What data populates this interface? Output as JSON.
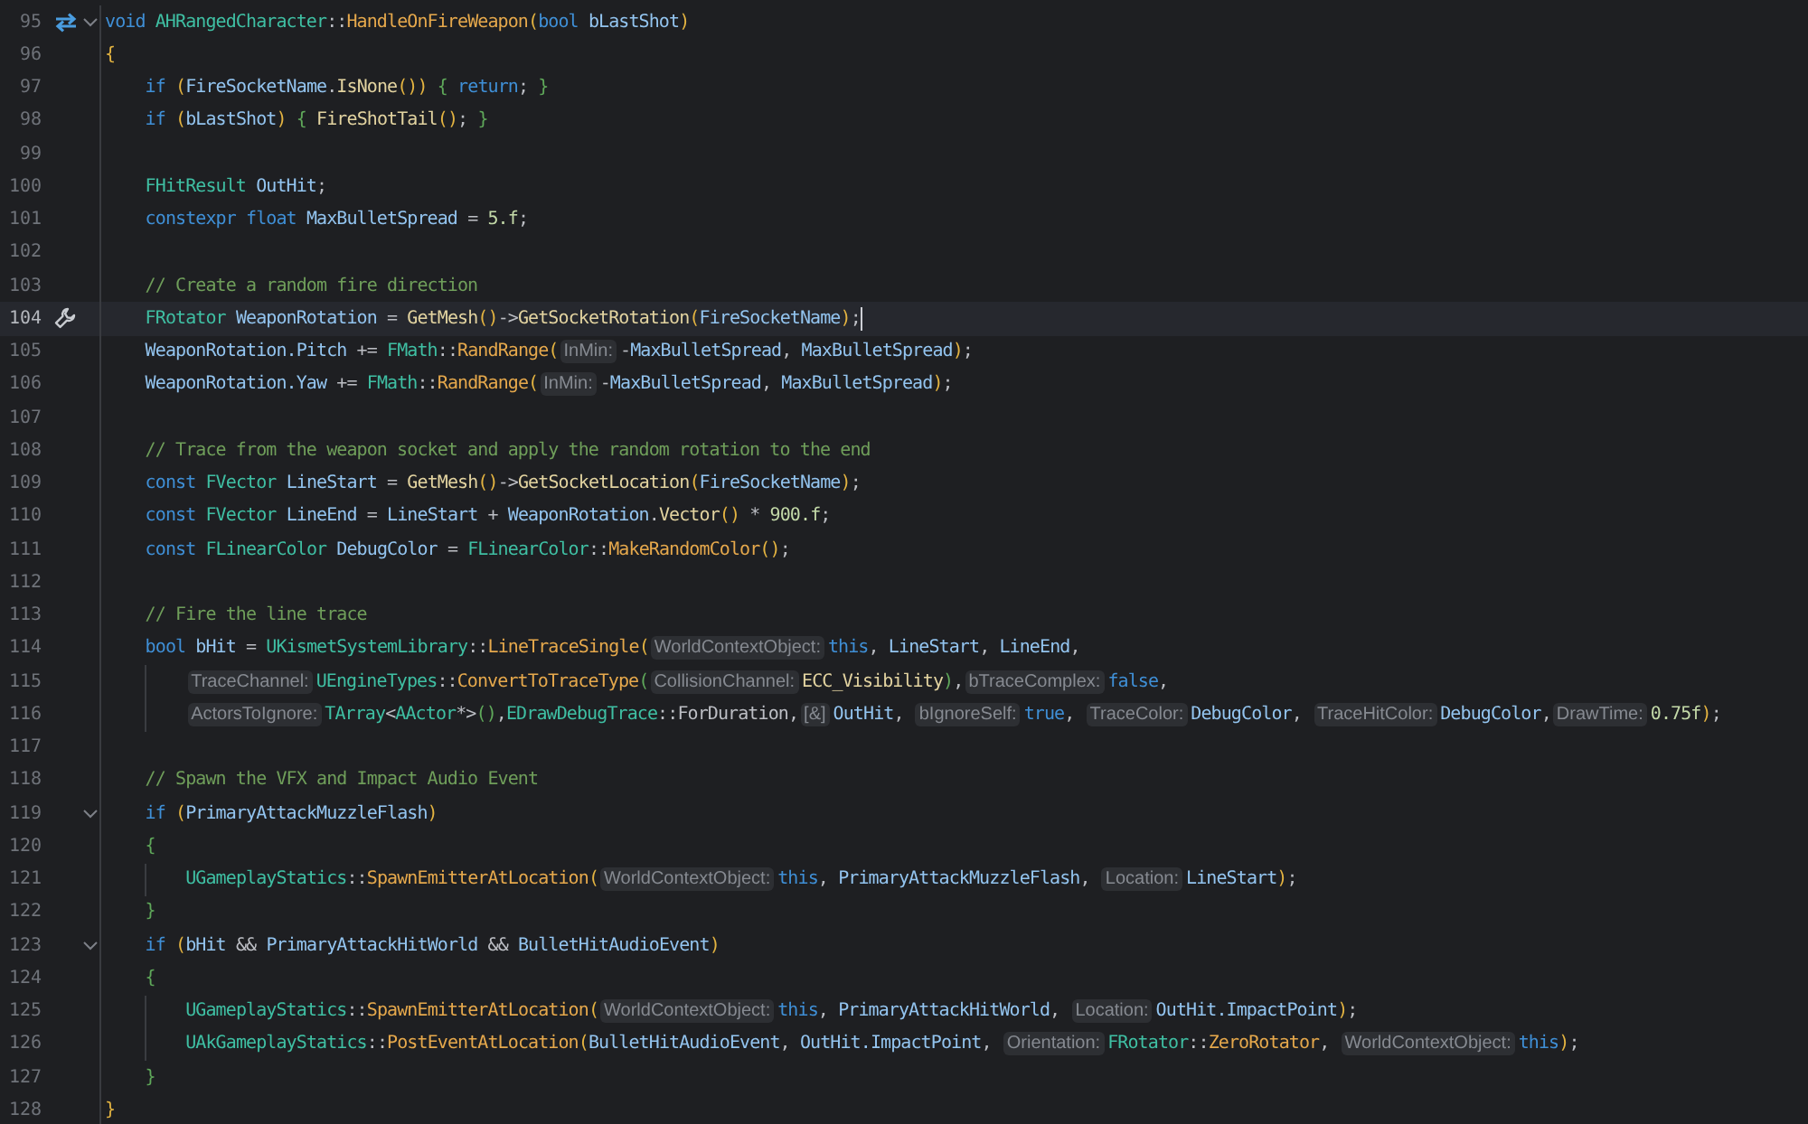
{
  "editor": {
    "lines": [
      {
        "number": "95",
        "current": false,
        "foldable": true,
        "gutter_icon": {
          "kind": "swap"
        },
        "tokens": [
          {
            "kind": "kw",
            "text": "void "
          },
          {
            "kind": "type",
            "text": "AHRangedCharacter"
          },
          {
            "kind": "p",
            "text": "::"
          },
          {
            "kind": "fn",
            "text": "HandleOnFireWeapon"
          },
          {
            "kind": "br",
            "text": "("
          },
          {
            "kind": "kw",
            "text": "bool "
          },
          {
            "kind": "var",
            "text": "bLastShot"
          },
          {
            "kind": "br",
            "text": ")"
          }
        ]
      },
      {
        "number": "96",
        "current": false,
        "foldable": false,
        "tokens": [
          {
            "kind": "br",
            "text": "{"
          }
        ],
        "children": [
          {
            "number": "97",
            "current": false,
            "foldable": false,
            "tokens": [
              {
                "kind": "kw",
                "text": "if "
              },
              {
                "kind": "br",
                "text": "("
              },
              {
                "kind": "var",
                "text": "FireSocketName"
              },
              {
                "kind": "p",
                "text": "."
              },
              {
                "kind": "mt",
                "text": "IsNone"
              },
              {
                "kind": "br",
                "text": "())"
              },
              {
                "kind": "bc",
                "text": " { "
              },
              {
                "kind": "kw",
                "text": "return"
              },
              {
                "kind": "p",
                "text": ";"
              },
              {
                "kind": "bc",
                "text": " }"
              }
            ]
          },
          {
            "number": "98",
            "current": false,
            "foldable": false,
            "tokens": [
              {
                "kind": "kw",
                "text": "if "
              },
              {
                "kind": "br",
                "text": "("
              },
              {
                "kind": "var",
                "text": "bLastShot"
              },
              {
                "kind": "br",
                "text": ")"
              },
              {
                "kind": "bc",
                "text": " { "
              },
              {
                "kind": "mt",
                "text": "FireShotTail"
              },
              {
                "kind": "br",
                "text": "()"
              },
              {
                "kind": "p",
                "text": ";"
              },
              {
                "kind": "bc",
                "text": " }"
              }
            ]
          },
          {
            "number": "99",
            "current": false,
            "foldable": false
          },
          {
            "number": "100",
            "current": false,
            "foldable": false,
            "tokens": [
              {
                "kind": "type",
                "text": "FHitResult "
              },
              {
                "kind": "var",
                "text": "OutHit"
              },
              {
                "kind": "p",
                "text": ";"
              }
            ]
          },
          {
            "number": "101",
            "current": false,
            "foldable": false,
            "tokens": [
              {
                "kind": "kw",
                "text": "constexpr float "
              },
              {
                "kind": "var",
                "text": "MaxBulletSpread"
              },
              {
                "kind": "p",
                "text": " = "
              },
              {
                "kind": "num",
                "text": "5.f"
              },
              {
                "kind": "p",
                "text": ";"
              }
            ]
          },
          {
            "number": "102",
            "current": false,
            "foldable": false
          },
          {
            "number": "103",
            "current": false,
            "foldable": false,
            "tokens": [
              {
                "kind": "cm",
                "text": "// Create a random fire direction"
              }
            ]
          },
          {
            "number": "104",
            "current": true,
            "foldable": false,
            "gutter_icon": {
              "kind": "wrench"
            },
            "tokens": [
              {
                "kind": "type",
                "text": "FRotator "
              },
              {
                "kind": "var",
                "text": "WeaponRotation"
              },
              {
                "kind": "p",
                "text": " = "
              },
              {
                "kind": "mt",
                "text": "GetMesh"
              },
              {
                "kind": "br",
                "text": "()"
              },
              {
                "kind": "p",
                "text": "->"
              },
              {
                "kind": "mt",
                "text": "GetSocketRotation"
              },
              {
                "kind": "br",
                "text": "("
              },
              {
                "kind": "var",
                "text": "FireSocketName"
              },
              {
                "kind": "br",
                "text": ")"
              },
              {
                "kind": "p",
                "text": ";"
              }
            ]
          },
          {
            "number": "105",
            "current": false,
            "foldable": false,
            "tokens": [
              {
                "kind": "var",
                "text": "WeaponRotation.Pitch"
              },
              {
                "kind": "p",
                "text": " += "
              },
              {
                "kind": "type",
                "text": "FMath"
              },
              {
                "kind": "p",
                "text": "::"
              },
              {
                "kind": "fn",
                "text": "RandRange"
              },
              {
                "kind": "br",
                "text": "("
              },
              {
                "kind": "hint",
                "text": "InMin:"
              },
              {
                "kind": "p",
                "text": "-"
              },
              {
                "kind": "var",
                "text": "MaxBulletSpread"
              },
              {
                "kind": "p",
                "text": ", "
              },
              {
                "kind": "var",
                "text": "MaxBulletSpread"
              },
              {
                "kind": "br",
                "text": ")"
              },
              {
                "kind": "p",
                "text": ";"
              }
            ]
          },
          {
            "number": "106",
            "current": false,
            "foldable": false,
            "tokens": [
              {
                "kind": "var",
                "text": "WeaponRotation.Yaw"
              },
              {
                "kind": "p",
                "text": " += "
              },
              {
                "kind": "type",
                "text": "FMath"
              },
              {
                "kind": "p",
                "text": "::"
              },
              {
                "kind": "fn",
                "text": "RandRange"
              },
              {
                "kind": "br",
                "text": "("
              },
              {
                "kind": "hint",
                "text": "InMin:"
              },
              {
                "kind": "p",
                "text": "-"
              },
              {
                "kind": "var",
                "text": "MaxBulletSpread"
              },
              {
                "kind": "p",
                "text": ", "
              },
              {
                "kind": "var",
                "text": "MaxBulletSpread"
              },
              {
                "kind": "br",
                "text": ")"
              },
              {
                "kind": "p",
                "text": ";"
              }
            ]
          },
          {
            "number": "107",
            "current": false,
            "foldable": false
          },
          {
            "number": "108",
            "current": false,
            "foldable": false,
            "tokens": [
              {
                "kind": "cm",
                "text": "// Trace from the weapon socket and apply the random rotation to the end"
              }
            ]
          },
          {
            "number": "109",
            "current": false,
            "foldable": false,
            "tokens": [
              {
                "kind": "kw",
                "text": "const "
              },
              {
                "kind": "type",
                "text": "FVector "
              },
              {
                "kind": "var",
                "text": "LineStart"
              },
              {
                "kind": "p",
                "text": " = "
              },
              {
                "kind": "mt",
                "text": "GetMesh"
              },
              {
                "kind": "br",
                "text": "()"
              },
              {
                "kind": "p",
                "text": "->"
              },
              {
                "kind": "mt",
                "text": "GetSocketLocation"
              },
              {
                "kind": "br",
                "text": "("
              },
              {
                "kind": "var",
                "text": "FireSocketName"
              },
              {
                "kind": "br",
                "text": ")"
              },
              {
                "kind": "p",
                "text": ";"
              }
            ]
          },
          {
            "number": "110",
            "current": false,
            "foldable": false,
            "tokens": [
              {
                "kind": "kw",
                "text": "const "
              },
              {
                "kind": "type",
                "text": "FVector "
              },
              {
                "kind": "var",
                "text": "LineEnd"
              },
              {
                "kind": "p",
                "text": " = "
              },
              {
                "kind": "var",
                "text": "LineStart"
              },
              {
                "kind": "p",
                "text": " + "
              },
              {
                "kind": "var",
                "text": "WeaponRotation"
              },
              {
                "kind": "p",
                "text": "."
              },
              {
                "kind": "mt",
                "text": "Vector"
              },
              {
                "kind": "br",
                "text": "()"
              },
              {
                "kind": "p",
                "text": " * "
              },
              {
                "kind": "num",
                "text": "900.f"
              },
              {
                "kind": "p",
                "text": ";"
              }
            ]
          },
          {
            "number": "111",
            "current": false,
            "foldable": false,
            "tokens": [
              {
                "kind": "kw",
                "text": "const "
              },
              {
                "kind": "type",
                "text": "FLinearColor "
              },
              {
                "kind": "var",
                "text": "DebugColor"
              },
              {
                "kind": "p",
                "text": " = "
              },
              {
                "kind": "type",
                "text": "FLinearColor"
              },
              {
                "kind": "p",
                "text": "::"
              },
              {
                "kind": "fn",
                "text": "MakeRandomColor"
              },
              {
                "kind": "br",
                "text": "()"
              },
              {
                "kind": "p",
                "text": ";"
              }
            ]
          },
          {
            "number": "112",
            "current": false,
            "foldable": false
          },
          {
            "number": "113",
            "current": false,
            "foldable": false,
            "tokens": [
              {
                "kind": "cm",
                "text": "// Fire the line trace"
              }
            ]
          },
          {
            "number": "114",
            "current": false,
            "foldable": false,
            "tokens": [
              {
                "kind": "kw",
                "text": "bool "
              },
              {
                "kind": "var",
                "text": "bHit"
              },
              {
                "kind": "p",
                "text": " = "
              },
              {
                "kind": "type",
                "text": "UKismetSystemLibrary"
              },
              {
                "kind": "p",
                "text": "::"
              },
              {
                "kind": "fn",
                "text": "LineTraceSingle"
              },
              {
                "kind": "br",
                "text": "("
              },
              {
                "kind": "hint",
                "text": "WorldContextObject:"
              },
              {
                "kind": "kw",
                "text": "this"
              },
              {
                "kind": "p",
                "text": ", "
              },
              {
                "kind": "var",
                "text": "LineStart"
              },
              {
                "kind": "p",
                "text": ", "
              },
              {
                "kind": "var",
                "text": "LineEnd"
              },
              {
                "kind": "p",
                "text": ","
              }
            ],
            "children": [
              {
                "number": "115",
                "current": false,
                "foldable": false,
                "tokens": [
                  {
                    "kind": "hint",
                    "text": "TraceChannel:"
                  },
                  {
                    "kind": "type",
                    "text": "UEngineTypes"
                  },
                  {
                    "kind": "p",
                    "text": "::"
                  },
                  {
                    "kind": "fn",
                    "text": "ConvertToTraceType"
                  },
                  {
                    "kind": "bc",
                    "text": "("
                  },
                  {
                    "kind": "hint",
                    "text": "CollisionChannel:"
                  },
                  {
                    "kind": "mt",
                    "text": "ECC_Visibility"
                  },
                  {
                    "kind": "bc",
                    "text": ")"
                  },
                  {
                    "kind": "p",
                    "text": ","
                  },
                  {
                    "kind": "hint",
                    "text": "bTraceComplex:"
                  },
                  {
                    "kind": "kw",
                    "text": "false"
                  },
                  {
                    "kind": "p",
                    "text": ","
                  }
                ]
              },
              {
                "number": "116",
                "current": false,
                "foldable": false,
                "tokens": [
                  {
                    "kind": "hint",
                    "text": "ActorsToIgnore:"
                  },
                  {
                    "kind": "type",
                    "text": "TArray"
                  },
                  {
                    "kind": "p",
                    "text": "<"
                  },
                  {
                    "kind": "type",
                    "text": "AActor"
                  },
                  {
                    "kind": "p",
                    "text": "*>"
                  },
                  {
                    "kind": "bc",
                    "text": "()"
                  },
                  {
                    "kind": "p",
                    "text": ","
                  },
                  {
                    "kind": "type",
                    "text": "EDrawDebugTrace"
                  },
                  {
                    "kind": "p",
                    "text": "::ForDuration,"
                  },
                  {
                    "kind": "hint",
                    "text": "[&]"
                  },
                  {
                    "kind": "var",
                    "text": "OutHit"
                  },
                  {
                    "kind": "p",
                    "text": ", "
                  },
                  {
                    "kind": "hint",
                    "text": "bIgnoreSelf:"
                  },
                  {
                    "kind": "kw",
                    "text": "true"
                  },
                  {
                    "kind": "p",
                    "text": ", "
                  },
                  {
                    "kind": "hint",
                    "text": "TraceColor:"
                  },
                  {
                    "kind": "var",
                    "text": "DebugColor"
                  },
                  {
                    "kind": "p",
                    "text": ", "
                  },
                  {
                    "kind": "hint",
                    "text": "TraceHitColor:"
                  },
                  {
                    "kind": "var",
                    "text": "DebugColor"
                  },
                  {
                    "kind": "p",
                    "text": ","
                  },
                  {
                    "kind": "hint",
                    "text": "DrawTime:"
                  },
                  {
                    "kind": "num",
                    "text": "0.75f"
                  },
                  {
                    "kind": "br",
                    "text": ")"
                  },
                  {
                    "kind": "p",
                    "text": ";"
                  }
                ]
              }
            ]
          },
          {
            "number": "117",
            "current": false,
            "foldable": false
          },
          {
            "number": "118",
            "current": false,
            "foldable": false,
            "tokens": [
              {
                "kind": "cm",
                "text": "// Spawn the VFX and Impact Audio Event"
              }
            ]
          },
          {
            "number": "119",
            "current": false,
            "foldable": true,
            "tokens": [
              {
                "kind": "kw",
                "text": "if "
              },
              {
                "kind": "br",
                "text": "("
              },
              {
                "kind": "var",
                "text": "PrimaryAttackMuzzleFlash"
              },
              {
                "kind": "br",
                "text": ")"
              }
            ]
          },
          {
            "number": "120",
            "current": false,
            "foldable": false,
            "tokens": [
              {
                "kind": "bc",
                "text": "{"
              }
            ],
            "children": [
              {
                "number": "121",
                "current": false,
                "foldable": false,
                "tokens": [
                  {
                    "kind": "type",
                    "text": "UGameplayStatics"
                  },
                  {
                    "kind": "p",
                    "text": "::"
                  },
                  {
                    "kind": "fn",
                    "text": "SpawnEmitterAtLocation"
                  },
                  {
                    "kind": "br",
                    "text": "("
                  },
                  {
                    "kind": "hint",
                    "text": "WorldContextObject:"
                  },
                  {
                    "kind": "kw",
                    "text": "this"
                  },
                  {
                    "kind": "p",
                    "text": ", "
                  },
                  {
                    "kind": "var",
                    "text": "PrimaryAttackMuzzleFlash"
                  },
                  {
                    "kind": "p",
                    "text": ", "
                  },
                  {
                    "kind": "hint",
                    "text": "Location:"
                  },
                  {
                    "kind": "var",
                    "text": "LineStart"
                  },
                  {
                    "kind": "br",
                    "text": ")"
                  },
                  {
                    "kind": "p",
                    "text": ";"
                  }
                ]
              }
            ]
          },
          {
            "number": "122",
            "current": false,
            "foldable": false,
            "tokens": [
              {
                "kind": "bc",
                "text": "}"
              }
            ]
          },
          {
            "number": "123",
            "current": false,
            "foldable": true,
            "tokens": [
              {
                "kind": "kw",
                "text": "if "
              },
              {
                "kind": "br",
                "text": "("
              },
              {
                "kind": "var",
                "text": "bHit"
              },
              {
                "kind": "p",
                "text": " && "
              },
              {
                "kind": "var",
                "text": "PrimaryAttackHitWorld"
              },
              {
                "kind": "p",
                "text": " && "
              },
              {
                "kind": "var",
                "text": "BulletHitAudioEvent"
              },
              {
                "kind": "br",
                "text": ")"
              }
            ]
          },
          {
            "number": "124",
            "current": false,
            "foldable": false,
            "tokens": [
              {
                "kind": "bc",
                "text": "{"
              }
            ],
            "children": [
              {
                "number": "125",
                "current": false,
                "foldable": false,
                "tokens": [
                  {
                    "kind": "type",
                    "text": "UGameplayStatics"
                  },
                  {
                    "kind": "p",
                    "text": "::"
                  },
                  {
                    "kind": "fn",
                    "text": "SpawnEmitterAtLocation"
                  },
                  {
                    "kind": "br",
                    "text": "("
                  },
                  {
                    "kind": "hint",
                    "text": "WorldContextObject:"
                  },
                  {
                    "kind": "kw",
                    "text": "this"
                  },
                  {
                    "kind": "p",
                    "text": ", "
                  },
                  {
                    "kind": "var",
                    "text": "PrimaryAttackHitWorld"
                  },
                  {
                    "kind": "p",
                    "text": ", "
                  },
                  {
                    "kind": "hint",
                    "text": "Location:"
                  },
                  {
                    "kind": "var",
                    "text": "OutHit.ImpactPoint"
                  },
                  {
                    "kind": "br",
                    "text": ")"
                  },
                  {
                    "kind": "p",
                    "text": ";"
                  }
                ]
              },
              {
                "number": "126",
                "current": false,
                "foldable": false,
                "tokens": [
                  {
                    "kind": "type",
                    "text": "UAkGameplayStatics"
                  },
                  {
                    "kind": "p",
                    "text": "::"
                  },
                  {
                    "kind": "fn",
                    "text": "PostEventAtLocation"
                  },
                  {
                    "kind": "br",
                    "text": "("
                  },
                  {
                    "kind": "var",
                    "text": "BulletHitAudioEvent"
                  },
                  {
                    "kind": "p",
                    "text": ", "
                  },
                  {
                    "kind": "var",
                    "text": "OutHit.ImpactPoint"
                  },
                  {
                    "kind": "p",
                    "text": ", "
                  },
                  {
                    "kind": "hint",
                    "text": "Orientation:"
                  },
                  {
                    "kind": "type",
                    "text": "FRotator"
                  },
                  {
                    "kind": "p",
                    "text": "::"
                  },
                  {
                    "kind": "fn",
                    "text": "ZeroRotator"
                  },
                  {
                    "kind": "p",
                    "text": ", "
                  },
                  {
                    "kind": "hint",
                    "text": "WorldContextObject:"
                  },
                  {
                    "kind": "kw",
                    "text": "this"
                  },
                  {
                    "kind": "br",
                    "text": ")"
                  },
                  {
                    "kind": "p",
                    "text": ";"
                  }
                ]
              }
            ]
          },
          {
            "number": "127",
            "current": false,
            "foldable": false,
            "tokens": [
              {
                "kind": "bc",
                "text": "}"
              }
            ]
          }
        ]
      },
      {
        "number": "128",
        "current": false,
        "foldable": false,
        "tokens": [
          {
            "kind": "br",
            "text": "}"
          }
        ]
      }
    ]
  }
}
